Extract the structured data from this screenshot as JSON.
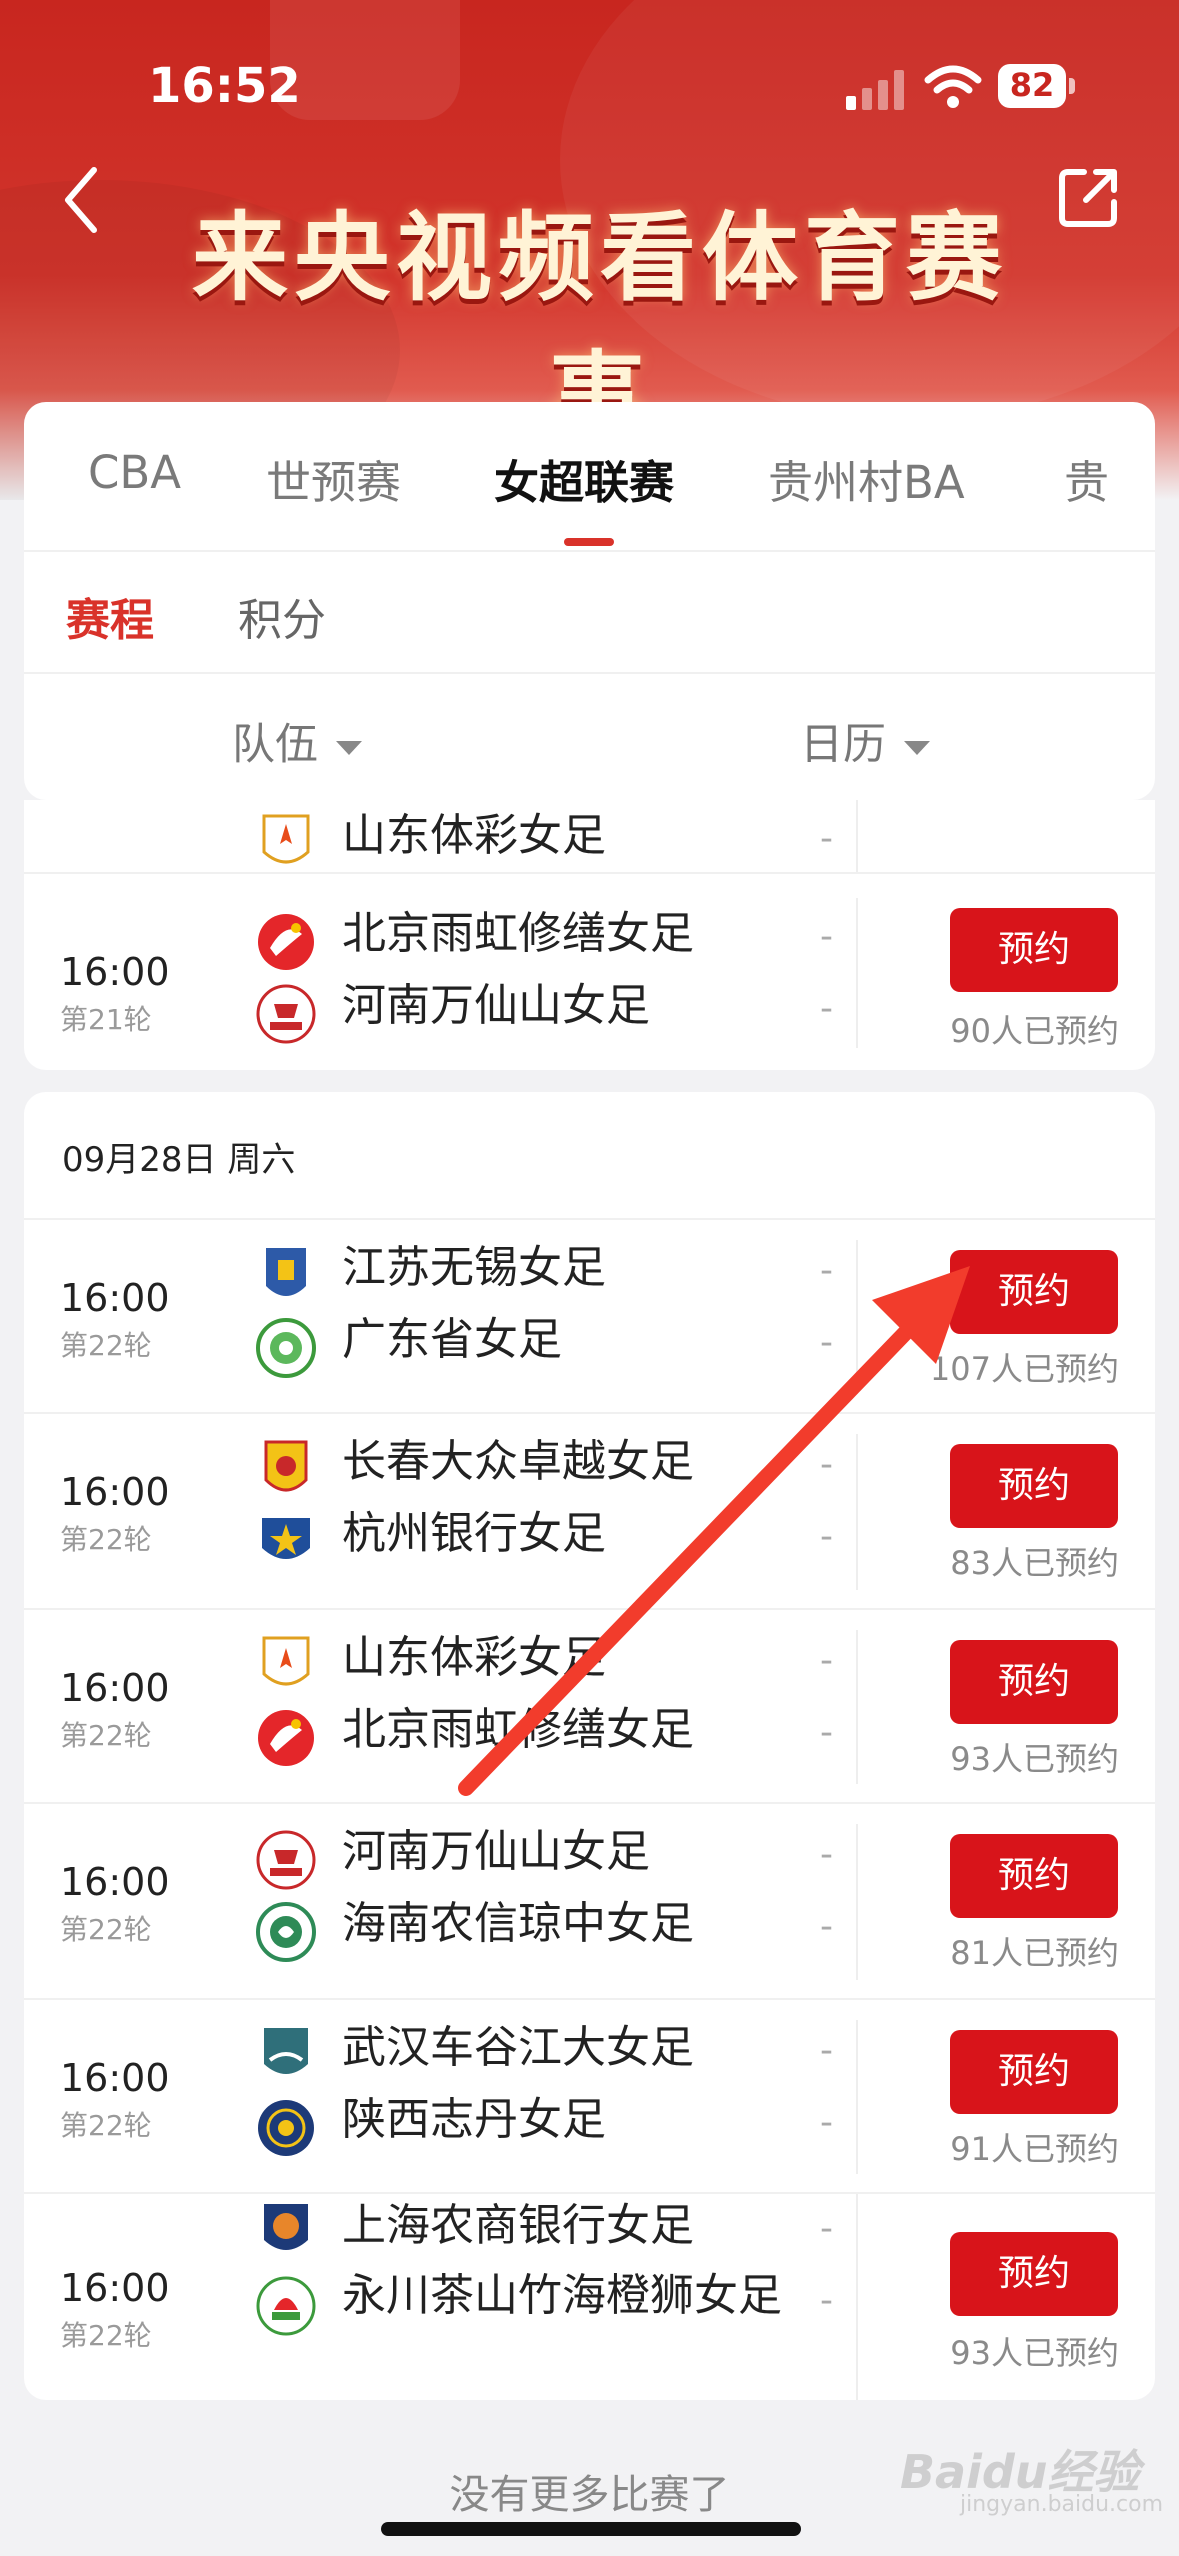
{
  "status": {
    "time": "16:52",
    "battery": "82"
  },
  "header": {
    "title": "来央视频看体育赛事"
  },
  "tabs": [
    {
      "label": "CBA"
    },
    {
      "label": "世预赛"
    },
    {
      "label": "女超联赛"
    },
    {
      "label": "贵州村BA"
    },
    {
      "label": "贵"
    }
  ],
  "subtabs": [
    {
      "label": "赛程"
    },
    {
      "label": "积分"
    }
  ],
  "filters": {
    "team": "队伍",
    "calendar": "日历"
  },
  "partial_row": {
    "team": "山东体彩女足",
    "score": "-"
  },
  "match_prev": {
    "time": "16:00",
    "round": "第21轮",
    "home": "北京雨虹修缮女足",
    "away": "河南万仙山女足",
    "home_score": "-",
    "away_score": "-",
    "button": "预约",
    "booked": "90人已预约"
  },
  "date_group": {
    "date": "09月28日 周六",
    "matches": [
      {
        "time": "16:00",
        "round": "第22轮",
        "home": "江苏无锡女足",
        "away": "广东省女足",
        "home_score": "-",
        "away_score": "-",
        "button": "预约",
        "booked": "107人已预约"
      },
      {
        "time": "16:00",
        "round": "第22轮",
        "home": "长春大众卓越女足",
        "away": "杭州银行女足",
        "home_score": "-",
        "away_score": "-",
        "button": "预约",
        "booked": "83人已预约"
      },
      {
        "time": "16:00",
        "round": "第22轮",
        "home": "山东体彩女足",
        "away": "北京雨虹修缮女足",
        "home_score": "-",
        "away_score": "-",
        "button": "预约",
        "booked": "93人已预约"
      },
      {
        "time": "16:00",
        "round": "第22轮",
        "home": "河南万仙山女足",
        "away": "海南农信琼中女足",
        "home_score": "-",
        "away_score": "-",
        "button": "预约",
        "booked": "81人已预约"
      },
      {
        "time": "16:00",
        "round": "第22轮",
        "home": "武汉车谷江大女足",
        "away": "陕西志丹女足",
        "home_score": "-",
        "away_score": "-",
        "button": "预约",
        "booked": "91人已预约"
      },
      {
        "time": "16:00",
        "round": "第22轮",
        "home": "上海农商银行女足",
        "away": "永川茶山竹海橙狮女足",
        "home_score": "-",
        "away_score": "-",
        "button": "预约",
        "booked": "93人已预约"
      }
    ]
  },
  "footer": {
    "no_more": "没有更多比赛了",
    "watermark": "Baidu经验",
    "watermark_sub": "jingyan.baidu.com"
  },
  "colors": {
    "accent": "#d8141a",
    "banner": "#c8261f",
    "arrow": "#f23c2c"
  }
}
